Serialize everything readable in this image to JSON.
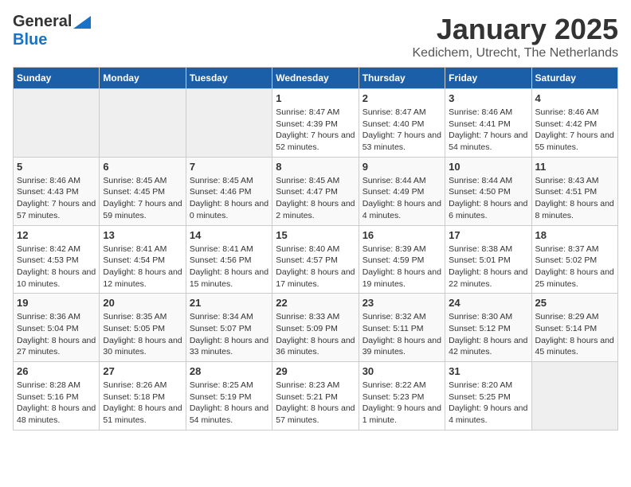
{
  "logo": {
    "general": "General",
    "blue": "Blue"
  },
  "title": "January 2025",
  "location": "Kedichem, Utrecht, The Netherlands",
  "days": [
    "Sunday",
    "Monday",
    "Tuesday",
    "Wednesday",
    "Thursday",
    "Friday",
    "Saturday"
  ],
  "weeks": [
    [
      {
        "day": "",
        "info": ""
      },
      {
        "day": "",
        "info": ""
      },
      {
        "day": "",
        "info": ""
      },
      {
        "day": "1",
        "info": "Sunrise: 8:47 AM\nSunset: 4:39 PM\nDaylight: 7 hours and 52 minutes."
      },
      {
        "day": "2",
        "info": "Sunrise: 8:47 AM\nSunset: 4:40 PM\nDaylight: 7 hours and 53 minutes."
      },
      {
        "day": "3",
        "info": "Sunrise: 8:46 AM\nSunset: 4:41 PM\nDaylight: 7 hours and 54 minutes."
      },
      {
        "day": "4",
        "info": "Sunrise: 8:46 AM\nSunset: 4:42 PM\nDaylight: 7 hours and 55 minutes."
      }
    ],
    [
      {
        "day": "5",
        "info": "Sunrise: 8:46 AM\nSunset: 4:43 PM\nDaylight: 7 hours and 57 minutes."
      },
      {
        "day": "6",
        "info": "Sunrise: 8:45 AM\nSunset: 4:45 PM\nDaylight: 7 hours and 59 minutes."
      },
      {
        "day": "7",
        "info": "Sunrise: 8:45 AM\nSunset: 4:46 PM\nDaylight: 8 hours and 0 minutes."
      },
      {
        "day": "8",
        "info": "Sunrise: 8:45 AM\nSunset: 4:47 PM\nDaylight: 8 hours and 2 minutes."
      },
      {
        "day": "9",
        "info": "Sunrise: 8:44 AM\nSunset: 4:49 PM\nDaylight: 8 hours and 4 minutes."
      },
      {
        "day": "10",
        "info": "Sunrise: 8:44 AM\nSunset: 4:50 PM\nDaylight: 8 hours and 6 minutes."
      },
      {
        "day": "11",
        "info": "Sunrise: 8:43 AM\nSunset: 4:51 PM\nDaylight: 8 hours and 8 minutes."
      }
    ],
    [
      {
        "day": "12",
        "info": "Sunrise: 8:42 AM\nSunset: 4:53 PM\nDaylight: 8 hours and 10 minutes."
      },
      {
        "day": "13",
        "info": "Sunrise: 8:41 AM\nSunset: 4:54 PM\nDaylight: 8 hours and 12 minutes."
      },
      {
        "day": "14",
        "info": "Sunrise: 8:41 AM\nSunset: 4:56 PM\nDaylight: 8 hours and 15 minutes."
      },
      {
        "day": "15",
        "info": "Sunrise: 8:40 AM\nSunset: 4:57 PM\nDaylight: 8 hours and 17 minutes."
      },
      {
        "day": "16",
        "info": "Sunrise: 8:39 AM\nSunset: 4:59 PM\nDaylight: 8 hours and 19 minutes."
      },
      {
        "day": "17",
        "info": "Sunrise: 8:38 AM\nSunset: 5:01 PM\nDaylight: 8 hours and 22 minutes."
      },
      {
        "day": "18",
        "info": "Sunrise: 8:37 AM\nSunset: 5:02 PM\nDaylight: 8 hours and 25 minutes."
      }
    ],
    [
      {
        "day": "19",
        "info": "Sunrise: 8:36 AM\nSunset: 5:04 PM\nDaylight: 8 hours and 27 minutes."
      },
      {
        "day": "20",
        "info": "Sunrise: 8:35 AM\nSunset: 5:05 PM\nDaylight: 8 hours and 30 minutes."
      },
      {
        "day": "21",
        "info": "Sunrise: 8:34 AM\nSunset: 5:07 PM\nDaylight: 8 hours and 33 minutes."
      },
      {
        "day": "22",
        "info": "Sunrise: 8:33 AM\nSunset: 5:09 PM\nDaylight: 8 hours and 36 minutes."
      },
      {
        "day": "23",
        "info": "Sunrise: 8:32 AM\nSunset: 5:11 PM\nDaylight: 8 hours and 39 minutes."
      },
      {
        "day": "24",
        "info": "Sunrise: 8:30 AM\nSunset: 5:12 PM\nDaylight: 8 hours and 42 minutes."
      },
      {
        "day": "25",
        "info": "Sunrise: 8:29 AM\nSunset: 5:14 PM\nDaylight: 8 hours and 45 minutes."
      }
    ],
    [
      {
        "day": "26",
        "info": "Sunrise: 8:28 AM\nSunset: 5:16 PM\nDaylight: 8 hours and 48 minutes."
      },
      {
        "day": "27",
        "info": "Sunrise: 8:26 AM\nSunset: 5:18 PM\nDaylight: 8 hours and 51 minutes."
      },
      {
        "day": "28",
        "info": "Sunrise: 8:25 AM\nSunset: 5:19 PM\nDaylight: 8 hours and 54 minutes."
      },
      {
        "day": "29",
        "info": "Sunrise: 8:23 AM\nSunset: 5:21 PM\nDaylight: 8 hours and 57 minutes."
      },
      {
        "day": "30",
        "info": "Sunrise: 8:22 AM\nSunset: 5:23 PM\nDaylight: 9 hours and 1 minute."
      },
      {
        "day": "31",
        "info": "Sunrise: 8:20 AM\nSunset: 5:25 PM\nDaylight: 9 hours and 4 minutes."
      },
      {
        "day": "",
        "info": ""
      }
    ]
  ]
}
